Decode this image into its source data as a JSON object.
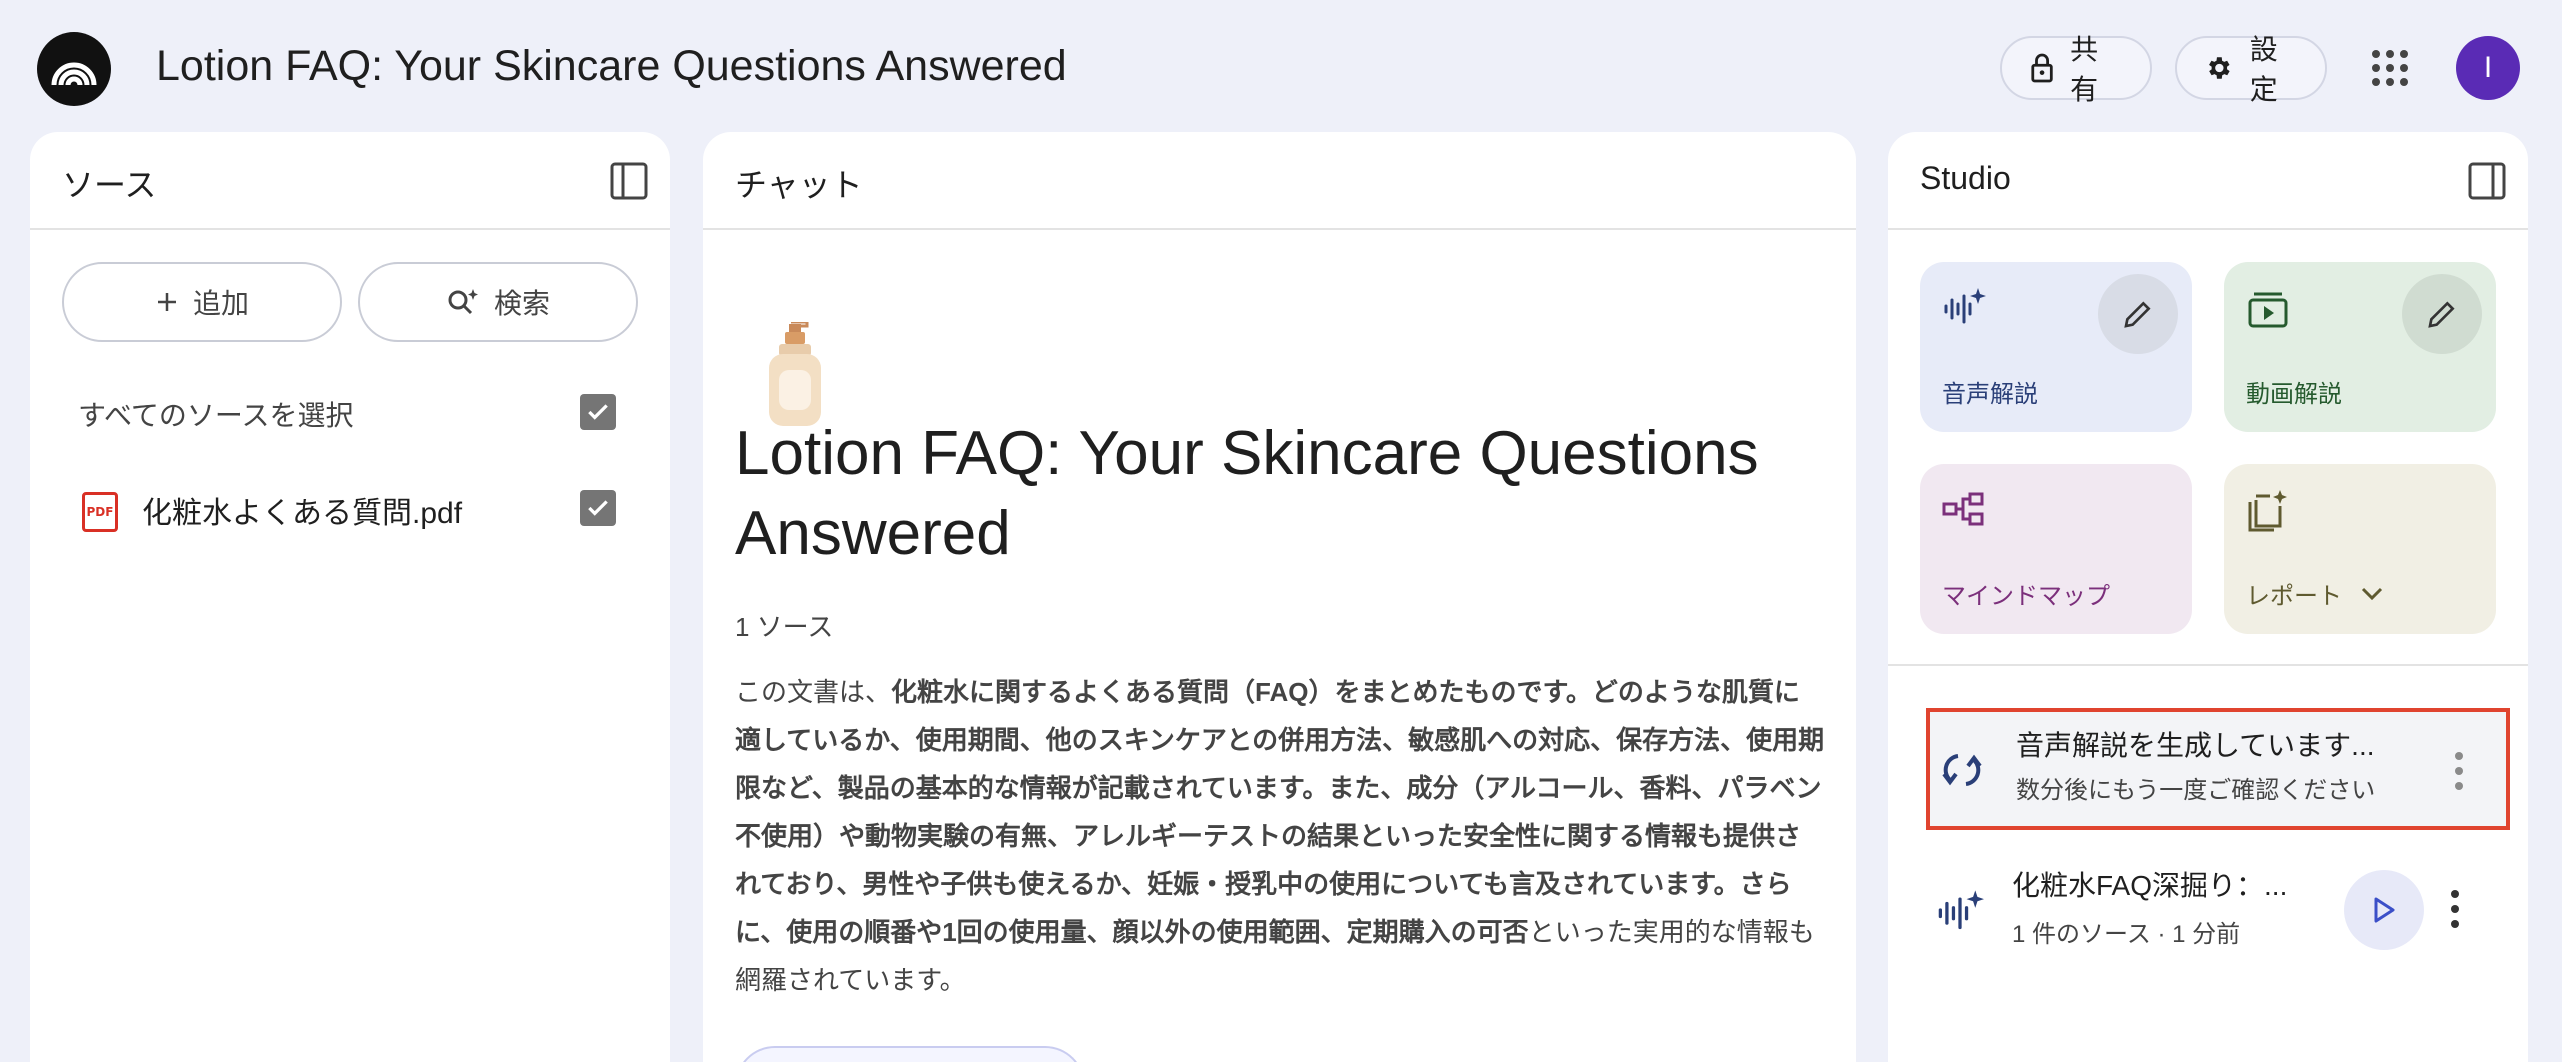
{
  "app": {
    "title": "Lotion FAQ: Your Skincare Questions Answered",
    "avatar_letter": "I"
  },
  "header": {
    "share_label": "共有",
    "settings_label": "設定"
  },
  "sources": {
    "title": "ソース",
    "add_label": "追加",
    "search_label": "検索",
    "select_all_label": "すべてのソースを選択",
    "select_all_checked": true,
    "files": [
      {
        "name": "化粧水よくある質問.pdf",
        "type_label": "PDF",
        "checked": true
      }
    ]
  },
  "chat": {
    "title": "チャット",
    "notebook_title": "Lotion FAQ: Your Skincare Questions Answered",
    "source_count": "1 ソース",
    "summary": [
      {
        "text": "この文書は、",
        "bold": false
      },
      {
        "text": "化粧水に関するよくある質問（FAQ）をまとめたものです。どのような肌質に適しているか、使用期間、他のスキンケアとの併用方法、敏感肌への対応、保存方法、使用期限など、製品の基本的な情報が記載されています。また、成分（アルコール、香料、パラベン不使用）や動物実験の有無、アレルギーテストの結果といった安全性に関する情報も提供されており、男性や子供も使えるか、妊娠・授乳中の使用についても言及されています。さらに、使用の順番や1回の使用量、顔以外の使用範囲、定期購入の可否",
        "bold": true
      },
      {
        "text": "といった実用的な情報も網羅されています。",
        "bold": false
      }
    ]
  },
  "studio": {
    "title": "Studio",
    "tiles": {
      "audio": "音声解説",
      "video": "動画解説",
      "mindmap": "マインドマップ",
      "report": "レポート"
    },
    "generating": {
      "title": "音声解説を生成しています...",
      "subtitle": "数分後にもう一度ご確認ください"
    },
    "completed": {
      "title": "化粧水FAQ深掘り：...",
      "subtitle": "1 件のソース · 1 分前"
    },
    "colors": {
      "highlight_border": "#e0442f",
      "audio_tile": "#e7ebf8",
      "video_tile": "#e2eee3",
      "mindmap_tile": "#f1e8f1",
      "report_tile": "#f1efe4"
    }
  }
}
